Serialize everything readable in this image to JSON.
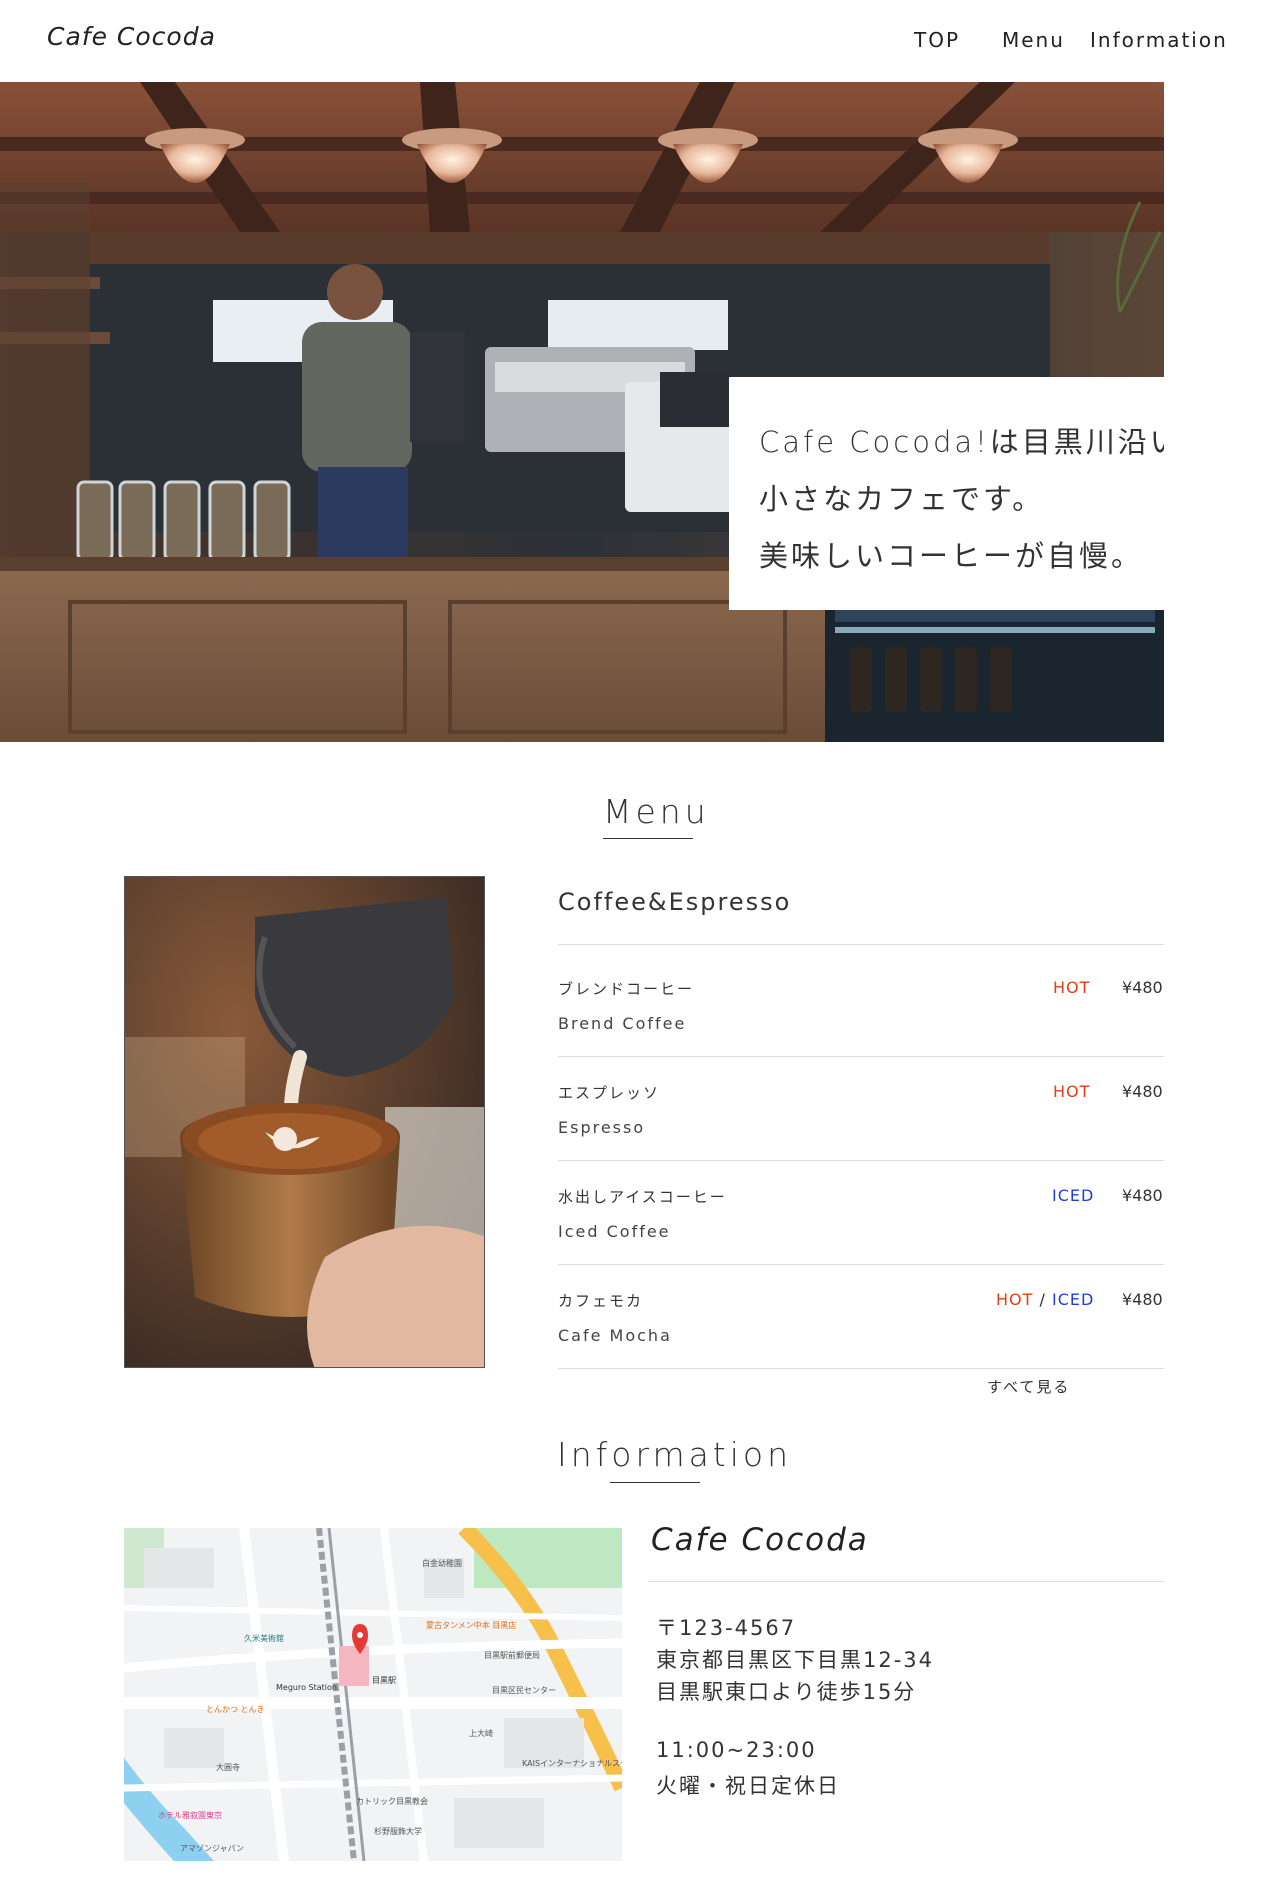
{
  "header": {
    "logo": "Cafe Cocoda",
    "nav": [
      "TOP",
      "Menu",
      "Information"
    ]
  },
  "hero": {
    "lines": [
      "Cafe Cocoda!は目黒川沿いの",
      "小さなカフェです。",
      "美味しいコーヒーが自慢。"
    ]
  },
  "menu": {
    "title": "Menu",
    "category": "Coffee&Espresso",
    "items": [
      {
        "jp": "ブレンドコーヒー",
        "en": "Brend Coffee",
        "hot": "HOT",
        "iced": "",
        "price": "¥480"
      },
      {
        "jp": "エスプレッソ",
        "en": "Espresso",
        "hot": "HOT",
        "iced": "",
        "price": "¥480"
      },
      {
        "jp": "水出しアイスコーヒー",
        "en": "Iced Coffee",
        "hot": "",
        "iced": "ICED",
        "price": "¥480"
      },
      {
        "jp": "カフェモカ",
        "en": "Cafe Mocha",
        "hot": "HOT",
        "iced": "ICED",
        "price": "¥480"
      }
    ],
    "see_all": "すべて見る"
  },
  "information": {
    "title": "Information",
    "name": "Cafe Cocoda",
    "lines": [
      "〒123-4567",
      "東京都目黒区下目黒12-34",
      "目黒駅東口より徒歩15分",
      "11:00~23:00",
      "火曜・祝日定休日"
    ],
    "map_labels": [
      "白金幼稚園",
      "久米美術館",
      "Meguro Station",
      "目黒駅",
      "とんかつ とんき",
      "大圓寺",
      "カトリック目黒教会",
      "KAISインターナショナルスクール東京",
      "目黒駅前郵便局",
      "目黒区民センター",
      "上大崎",
      "杉野服飾大学",
      "ホテル雅叙園東京",
      "アマゾンジャパン",
      "蒙古タンメン中本 目黒店"
    ]
  },
  "colors": {
    "hot": "#e0400c",
    "iced": "#1f3fd8"
  }
}
